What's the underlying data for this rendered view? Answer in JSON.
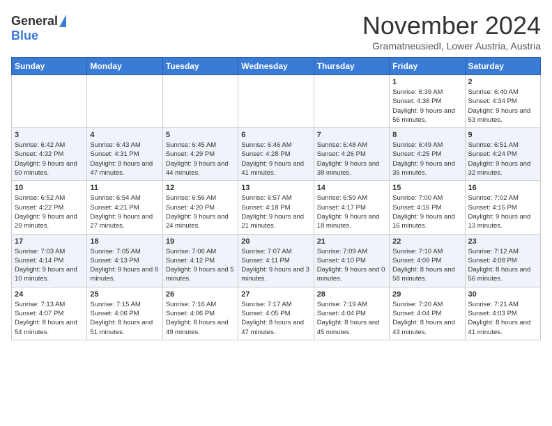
{
  "header": {
    "logo_general": "General",
    "logo_blue": "Blue",
    "title": "November 2024",
    "location": "Gramatneusiedl, Lower Austria, Austria"
  },
  "weekdays": [
    "Sunday",
    "Monday",
    "Tuesday",
    "Wednesday",
    "Thursday",
    "Friday",
    "Saturday"
  ],
  "weeks": [
    [
      {
        "day": "",
        "sunrise": "",
        "sunset": "",
        "daylight": ""
      },
      {
        "day": "",
        "sunrise": "",
        "sunset": "",
        "daylight": ""
      },
      {
        "day": "",
        "sunrise": "",
        "sunset": "",
        "daylight": ""
      },
      {
        "day": "",
        "sunrise": "",
        "sunset": "",
        "daylight": ""
      },
      {
        "day": "",
        "sunrise": "",
        "sunset": "",
        "daylight": ""
      },
      {
        "day": "1",
        "sunrise": "Sunrise: 6:39 AM",
        "sunset": "Sunset: 4:36 PM",
        "daylight": "Daylight: 9 hours and 56 minutes."
      },
      {
        "day": "2",
        "sunrise": "Sunrise: 6:40 AM",
        "sunset": "Sunset: 4:34 PM",
        "daylight": "Daylight: 9 hours and 53 minutes."
      }
    ],
    [
      {
        "day": "3",
        "sunrise": "Sunrise: 6:42 AM",
        "sunset": "Sunset: 4:32 PM",
        "daylight": "Daylight: 9 hours and 50 minutes."
      },
      {
        "day": "4",
        "sunrise": "Sunrise: 6:43 AM",
        "sunset": "Sunset: 4:31 PM",
        "daylight": "Daylight: 9 hours and 47 minutes."
      },
      {
        "day": "5",
        "sunrise": "Sunrise: 6:45 AM",
        "sunset": "Sunset: 4:29 PM",
        "daylight": "Daylight: 9 hours and 44 minutes."
      },
      {
        "day": "6",
        "sunrise": "Sunrise: 6:46 AM",
        "sunset": "Sunset: 4:28 PM",
        "daylight": "Daylight: 9 hours and 41 minutes."
      },
      {
        "day": "7",
        "sunrise": "Sunrise: 6:48 AM",
        "sunset": "Sunset: 4:26 PM",
        "daylight": "Daylight: 9 hours and 38 minutes."
      },
      {
        "day": "8",
        "sunrise": "Sunrise: 6:49 AM",
        "sunset": "Sunset: 4:25 PM",
        "daylight": "Daylight: 9 hours and 35 minutes."
      },
      {
        "day": "9",
        "sunrise": "Sunrise: 6:51 AM",
        "sunset": "Sunset: 4:24 PM",
        "daylight": "Daylight: 9 hours and 32 minutes."
      }
    ],
    [
      {
        "day": "10",
        "sunrise": "Sunrise: 6:52 AM",
        "sunset": "Sunset: 4:22 PM",
        "daylight": "Daylight: 9 hours and 29 minutes."
      },
      {
        "day": "11",
        "sunrise": "Sunrise: 6:54 AM",
        "sunset": "Sunset: 4:21 PM",
        "daylight": "Daylight: 9 hours and 27 minutes."
      },
      {
        "day": "12",
        "sunrise": "Sunrise: 6:56 AM",
        "sunset": "Sunset: 4:20 PM",
        "daylight": "Daylight: 9 hours and 24 minutes."
      },
      {
        "day": "13",
        "sunrise": "Sunrise: 6:57 AM",
        "sunset": "Sunset: 4:18 PM",
        "daylight": "Daylight: 9 hours and 21 minutes."
      },
      {
        "day": "14",
        "sunrise": "Sunrise: 6:59 AM",
        "sunset": "Sunset: 4:17 PM",
        "daylight": "Daylight: 9 hours and 18 minutes."
      },
      {
        "day": "15",
        "sunrise": "Sunrise: 7:00 AM",
        "sunset": "Sunset: 4:16 PM",
        "daylight": "Daylight: 9 hours and 16 minutes."
      },
      {
        "day": "16",
        "sunrise": "Sunrise: 7:02 AM",
        "sunset": "Sunset: 4:15 PM",
        "daylight": "Daylight: 9 hours and 13 minutes."
      }
    ],
    [
      {
        "day": "17",
        "sunrise": "Sunrise: 7:03 AM",
        "sunset": "Sunset: 4:14 PM",
        "daylight": "Daylight: 9 hours and 10 minutes."
      },
      {
        "day": "18",
        "sunrise": "Sunrise: 7:05 AM",
        "sunset": "Sunset: 4:13 PM",
        "daylight": "Daylight: 9 hours and 8 minutes."
      },
      {
        "day": "19",
        "sunrise": "Sunrise: 7:06 AM",
        "sunset": "Sunset: 4:12 PM",
        "daylight": "Daylight: 9 hours and 5 minutes."
      },
      {
        "day": "20",
        "sunrise": "Sunrise: 7:07 AM",
        "sunset": "Sunset: 4:11 PM",
        "daylight": "Daylight: 9 hours and 3 minutes."
      },
      {
        "day": "21",
        "sunrise": "Sunrise: 7:09 AM",
        "sunset": "Sunset: 4:10 PM",
        "daylight": "Daylight: 9 hours and 0 minutes."
      },
      {
        "day": "22",
        "sunrise": "Sunrise: 7:10 AM",
        "sunset": "Sunset: 4:09 PM",
        "daylight": "Daylight: 8 hours and 58 minutes."
      },
      {
        "day": "23",
        "sunrise": "Sunrise: 7:12 AM",
        "sunset": "Sunset: 4:08 PM",
        "daylight": "Daylight: 8 hours and 56 minutes."
      }
    ],
    [
      {
        "day": "24",
        "sunrise": "Sunrise: 7:13 AM",
        "sunset": "Sunset: 4:07 PM",
        "daylight": "Daylight: 8 hours and 54 minutes."
      },
      {
        "day": "25",
        "sunrise": "Sunrise: 7:15 AM",
        "sunset": "Sunset: 4:06 PM",
        "daylight": "Daylight: 8 hours and 51 minutes."
      },
      {
        "day": "26",
        "sunrise": "Sunrise: 7:16 AM",
        "sunset": "Sunset: 4:06 PM",
        "daylight": "Daylight: 8 hours and 49 minutes."
      },
      {
        "day": "27",
        "sunrise": "Sunrise: 7:17 AM",
        "sunset": "Sunset: 4:05 PM",
        "daylight": "Daylight: 8 hours and 47 minutes."
      },
      {
        "day": "28",
        "sunrise": "Sunrise: 7:19 AM",
        "sunset": "Sunset: 4:04 PM",
        "daylight": "Daylight: 8 hours and 45 minutes."
      },
      {
        "day": "29",
        "sunrise": "Sunrise: 7:20 AM",
        "sunset": "Sunset: 4:04 PM",
        "daylight": "Daylight: 8 hours and 43 minutes."
      },
      {
        "day": "30",
        "sunrise": "Sunrise: 7:21 AM",
        "sunset": "Sunset: 4:03 PM",
        "daylight": "Daylight: 8 hours and 41 minutes."
      }
    ]
  ]
}
